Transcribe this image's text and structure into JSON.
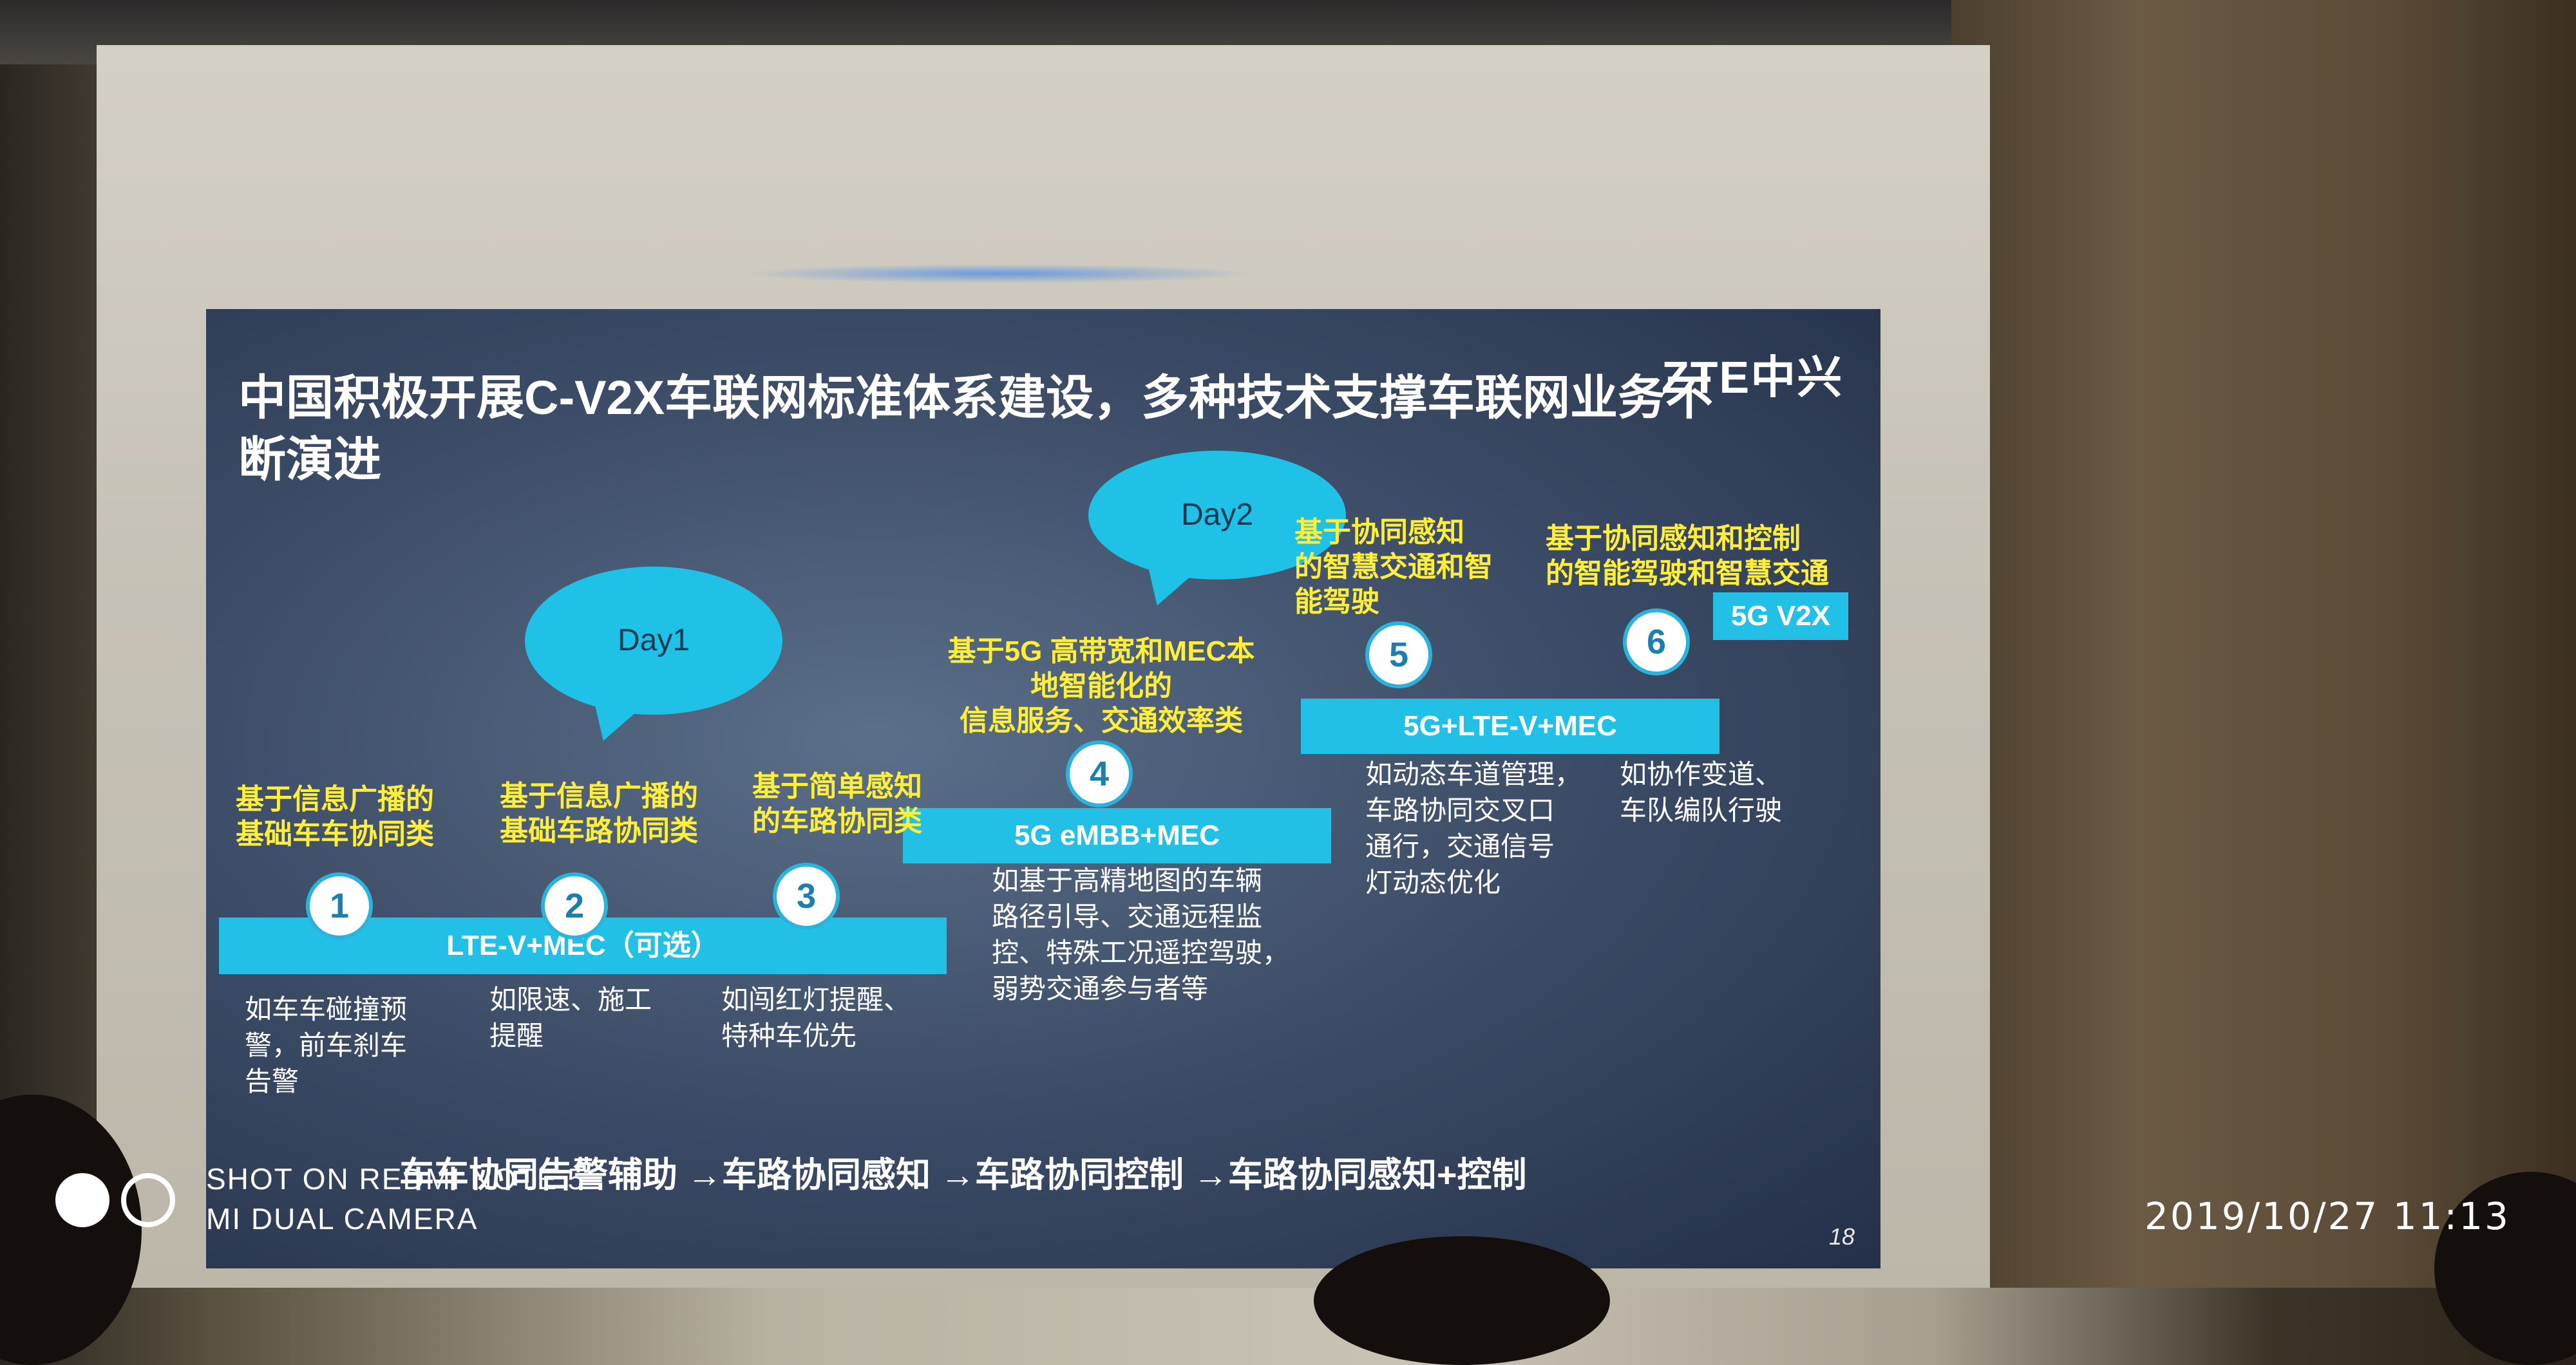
{
  "slide": {
    "title": "中国积极开展C-V2X车联网标准体系建设，多种技术支撑车联网业务不断演进",
    "logo": "ZTE中兴",
    "day1": "Day1",
    "day2": "Day2",
    "bars": {
      "lte": "LTE-V+MEC（可选）",
      "embb": "5G eMBB+MEC",
      "lte5g": "5G+LTE-V+MEC",
      "v2x": "5G V2X"
    },
    "stages": [
      {
        "num": "1",
        "label": "基于信息广播的\n基础车车协同类",
        "desc": "如车车碰撞预\n警，前车刹车\n告警"
      },
      {
        "num": "2",
        "label": "基于信息广播的\n基础车路协同类",
        "desc": "如限速、施工\n提醒"
      },
      {
        "num": "3",
        "label": "基于简单感知\n的车路协同类",
        "desc": "如闯红灯提醒、\n特种车优先"
      },
      {
        "num": "4",
        "label": "基于5G 高带宽和MEC本\n地智能化的\n信息服务、交通效率类",
        "desc": "如基于高精地图的车辆\n路径引导、交通远程监\n控、特殊工况遥控驾驶，\n弱势交通参与者等"
      },
      {
        "num": "5",
        "label": "基于协同感知\n的智慧交通和智\n能驾驶",
        "desc": "如动态车道管理，\n车路协同交叉口\n通行，交通信号\n灯动态优化"
      },
      {
        "num": "6",
        "label": "基于协同感知和控制\n的智能驾驶和智慧交通",
        "desc": "如协作变道、\n车队编队行驶"
      }
    ],
    "footer": "车车协同告警辅助  →车路协同感知  →车路协同控制  →车路协同感知+控制",
    "page_number": "18"
  },
  "watermark": {
    "line1": "SHOT ON REDMI NOTE 5",
    "line2": "MI DUAL CAMERA"
  },
  "timestamp": "2019/10/27  11:13"
}
